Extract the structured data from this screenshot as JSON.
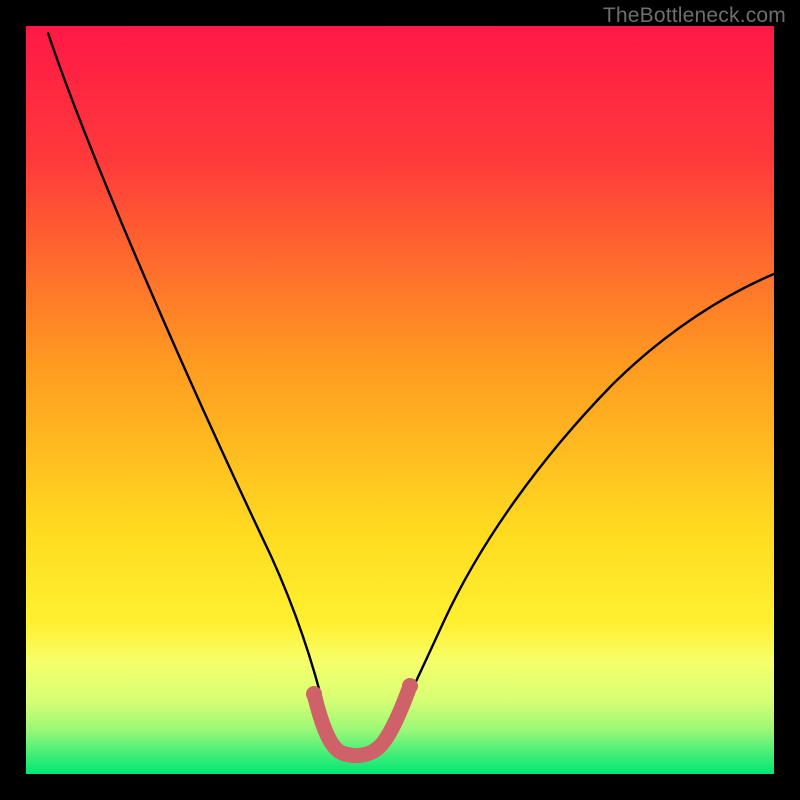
{
  "watermark": "TheBottleneck.com",
  "chart_data": {
    "type": "line",
    "title": "",
    "xlabel": "",
    "ylabel": "",
    "xlim": [
      0,
      100
    ],
    "ylim": [
      0,
      100
    ],
    "grid": false,
    "legend": false,
    "series": [
      {
        "name": "curve",
        "x": [
          3,
          10,
          20,
          30,
          35,
          38,
          40,
          41,
          43,
          45,
          47,
          50,
          53,
          57,
          63,
          72,
          85,
          100
        ],
        "y": [
          99,
          78,
          53,
          28,
          15,
          9,
          5,
          3.5,
          2.5,
          2.5,
          2.5,
          3.5,
          7,
          15,
          27,
          40,
          53,
          62
        ]
      },
      {
        "name": "bottom-highlight",
        "x": [
          38,
          40,
          41,
          43,
          45,
          47,
          50
        ],
        "y": [
          9,
          5,
          3.5,
          2.5,
          2.5,
          2.5,
          3.5
        ]
      }
    ],
    "background_gradient": {
      "top": "#ff1846",
      "mid": "#ffdc20",
      "lower_band": "#f6ff6a",
      "bottom": "#00e874"
    },
    "highlight_color": "#cf6268"
  }
}
